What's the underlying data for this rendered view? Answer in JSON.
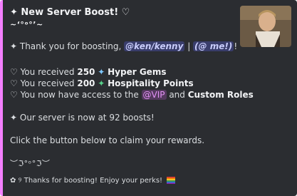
{
  "embed": {
    "accent_color": "#f47fff",
    "title": "✦ New Server Boost! ♡",
    "kaomoji": "~‘°ᵒ°’~",
    "thanks": {
      "prefix": "✦ Thank you for boosting, ",
      "mention_user": "@ken/kenny",
      "separator": " | ",
      "mention_me": "(@ me!)",
      "suffix": "!"
    },
    "rewards": [
      {
        "prefix": "♡ You received ",
        "amount": "250",
        "icon": "sparkle-icon",
        "label": "Hyper Gems"
      },
      {
        "prefix": "♡ You received ",
        "amount": "200",
        "icon": "sparkle-icon",
        "label": "Hospitality Points"
      }
    ],
    "access": {
      "prefix": "♡ You now have access to the ",
      "role": "@VIP",
      "middle": " and ",
      "feature": "Custom Roles"
    },
    "boost_count": "✦ Our server is now at 92 boosts!",
    "claim_text": "Click the button below to claim your rewards.",
    "divider": "︶ℑ°ᵒ°ℑ︶",
    "footer": "✿ ୨ Thanks for boosting! Enjoy your perks!",
    "footer_icon": "rainbow-flag-icon",
    "thumbnail": "boost-thumbnail-image"
  }
}
